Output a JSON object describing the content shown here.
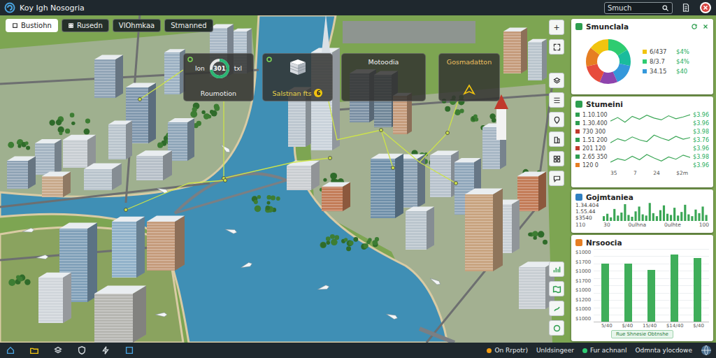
{
  "window": {
    "title": "Koy Igh Nosogria"
  },
  "search": {
    "placeholder": "Smuch"
  },
  "toolbar": [
    {
      "label": "Bustiohn",
      "selected": true
    },
    {
      "label": "Rusedn",
      "selected": false
    },
    {
      "label": "VlOhmkaa",
      "selected": false
    },
    {
      "label": "Stmanned",
      "selected": false
    }
  ],
  "map": {
    "zoom": "+",
    "cards": [
      {
        "kind": "donut",
        "prefix": "Ion",
        "value": "301",
        "suffix": "txl",
        "level": 0.72,
        "title": "Roumotion"
      },
      {
        "kind": "building",
        "title": "Salstnan fts",
        "badge": "6"
      },
      {
        "kind": "label",
        "title": "Motoodia"
      },
      {
        "kind": "arrow",
        "title": "Gosmadatton"
      }
    ]
  },
  "panels": {
    "summary": {
      "title": "Smunclala",
      "segments": [
        {
          "value": 16,
          "color": "#2ecc71"
        },
        {
          "value": 12,
          "color": "#1abc9c"
        },
        {
          "value": 15,
          "color": "#3498db"
        },
        {
          "value": 13,
          "color": "#8e44ad"
        },
        {
          "value": 15,
          "color": "#e74c3c"
        },
        {
          "value": 14,
          "color": "#e67e22"
        },
        {
          "value": 15,
          "color": "#f1c40f"
        }
      ],
      "legend": [
        {
          "label": "6/437",
          "value": "$4%",
          "color": "#f1c40f"
        },
        {
          "label": "8/3.7",
          "value": "$4%",
          "color": "#2ecc71"
        },
        {
          "label": "34.15",
          "value": "$40",
          "color": "#3498db"
        }
      ]
    },
    "stats": {
      "title": "Stumeini",
      "rows": [
        {
          "label": "1.10.100",
          "value": "$3.96",
          "color": "#2e9e4f"
        },
        {
          "label": "1.30.400",
          "value": "$3.96",
          "color": "#2e9e4f"
        },
        {
          "label": "730 300",
          "value": "$3.98",
          "color": "#c0392b"
        },
        {
          "label": "1.51 200",
          "value": "$3.76",
          "color": "#2e9e4f"
        },
        {
          "label": "201 120",
          "value": "$3.96",
          "color": "#c0392b"
        },
        {
          "label": "2.65 350",
          "value": "$3.98",
          "color": "#2e9e4f"
        },
        {
          "label": "120 0",
          "value": "$3.96",
          "color": "#e67e22"
        }
      ],
      "series": [
        [
          82,
          88,
          80,
          90,
          85,
          92,
          87,
          84,
          91,
          86,
          89,
          93
        ],
        [
          45,
          52,
          48,
          55,
          50,
          47,
          58,
          53,
          49,
          56,
          51,
          54
        ],
        [
          12,
          18,
          15,
          22,
          16,
          25,
          19,
          14,
          21,
          17,
          24,
          20
        ]
      ],
      "ticks": [
        "35",
        "7",
        "24",
        "$2m"
      ]
    },
    "compare": {
      "title": "Gojmtaniea",
      "rows": [
        "1.34.404",
        "1.55.44",
        "$3540"
      ],
      "values": [
        8,
        12,
        6,
        20,
        9,
        14,
        28,
        10,
        7,
        16,
        24,
        11,
        9,
        30,
        13,
        8,
        18,
        26,
        12,
        10,
        22,
        9,
        15,
        27,
        11,
        8,
        19,
        13,
        24,
        10
      ],
      "ticks": [
        "110",
        "30",
        "0ulhna",
        "0ulhte",
        "100"
      ]
    },
    "revenue": {
      "title": "Nrsoocia",
      "y_ticks": [
        "$1000",
        "$1700",
        "$1000",
        "$1700",
        "$1000",
        "$1200",
        "$1000",
        "$1000"
      ],
      "values": [
        1300,
        1300,
        1150,
        1500,
        1420
      ],
      "x_ticks": [
        "5/40",
        "$/40",
        "15/40",
        "$14/40",
        "$/40"
      ],
      "footer": "Rue Shnesie Obtnshe"
    }
  },
  "status_bar": {
    "items": [
      {
        "label": "On Rrpotr)",
        "color": "#f39c12"
      },
      {
        "label": "Unldsingeer"
      },
      {
        "label": "Fur achnanl",
        "color": "#2ecc71"
      },
      {
        "label": "Odmnta ylocdowe"
      }
    ]
  }
}
